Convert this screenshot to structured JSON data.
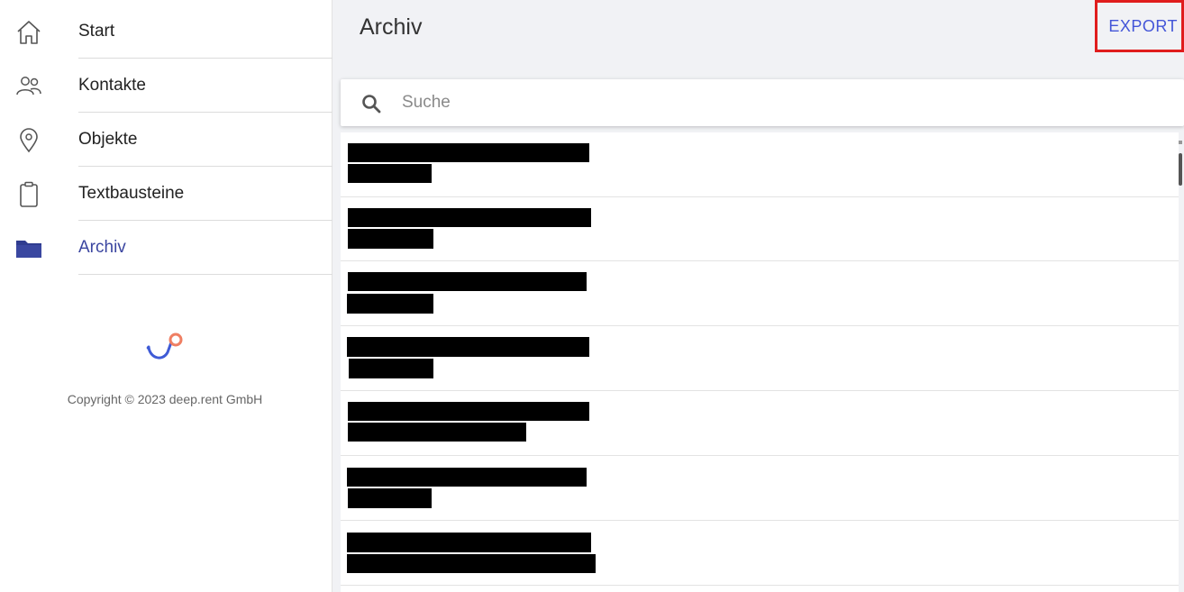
{
  "sidebar": {
    "items": [
      {
        "label": "Start",
        "icon": "home-icon",
        "active": false
      },
      {
        "label": "Kontakte",
        "icon": "contacts-icon",
        "active": false
      },
      {
        "label": "Objekte",
        "icon": "location-pin-icon",
        "active": false
      },
      {
        "label": "Textbausteine",
        "icon": "clipboard-icon",
        "active": false
      },
      {
        "label": "Archiv",
        "icon": "folder-icon",
        "active": true
      }
    ],
    "copyright": "Copyright © 2023 deep.rent GmbH"
  },
  "header": {
    "title": "Archiv",
    "export_label": "EXPORT"
  },
  "search": {
    "placeholder": "Suche",
    "value": ""
  },
  "colors": {
    "accent": "#3b46a0",
    "export_text": "#4355d8",
    "highlight_border": "#e01d1d",
    "logo_blue": "#3f5bd6",
    "logo_orange": "#ef7f63",
    "main_bg": "#f1f2f5"
  }
}
